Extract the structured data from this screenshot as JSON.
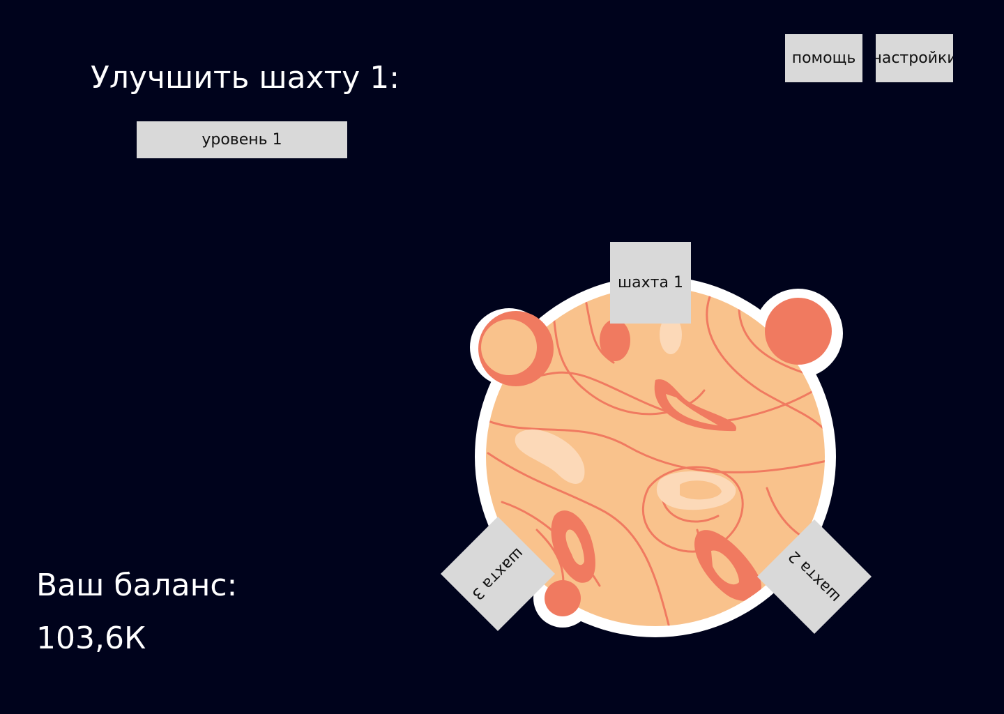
{
  "upgrade": {
    "title": "Улучшить шахту 1:",
    "level_label": "уровень 1"
  },
  "top_buttons": {
    "help_label": "помощь",
    "settings_label": "настройки"
  },
  "balance": {
    "label": "Ваш баланс:",
    "value": "103,6К"
  },
  "mines": {
    "mine1_label": "шахта 1",
    "mine2_label": "шахта 2",
    "mine3_label": "шахта 3"
  },
  "colors": {
    "background": "#00031c",
    "planet_fill": "#f9c28c",
    "planet_accent": "#f07a60",
    "planet_outline": "#ffffff",
    "button_fill": "#d9d9d9"
  },
  "icons": {
    "planet": "planet-icon"
  }
}
